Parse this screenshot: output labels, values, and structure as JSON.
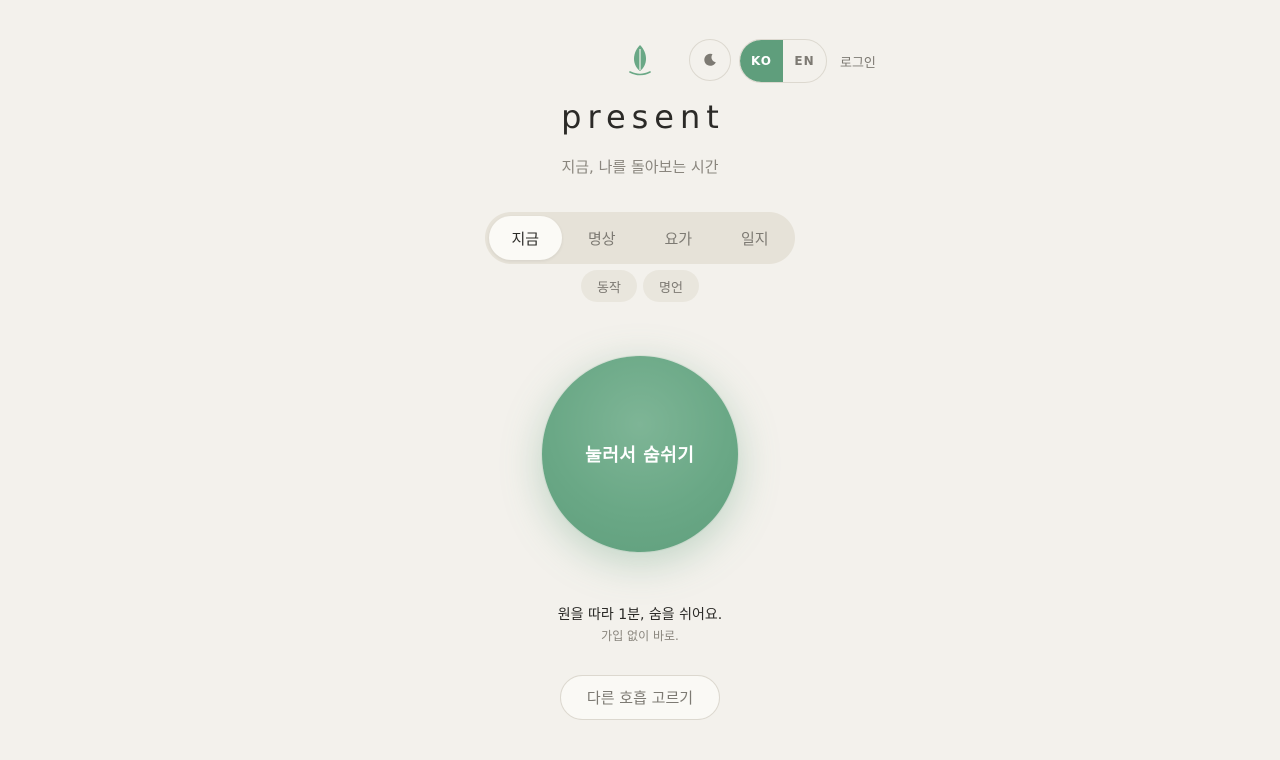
{
  "header": {
    "logo_icon": "leaf-icon",
    "theme_icon": "moon-icon",
    "languages": [
      {
        "code": "KO",
        "active": true
      },
      {
        "code": "EN",
        "active": false
      }
    ],
    "login_label": "로그인"
  },
  "hero": {
    "title": "present",
    "subtitle": "지금, 나를 돌아보는 시간"
  },
  "tabs": {
    "main": [
      {
        "label": "지금",
        "active": true
      },
      {
        "label": "명상",
        "active": false
      },
      {
        "label": "요가",
        "active": false
      },
      {
        "label": "일지",
        "active": false
      }
    ],
    "sub": [
      {
        "label": "동작"
      },
      {
        "label": "명언"
      }
    ]
  },
  "breath": {
    "button_label": "눌러서 숨쉬기",
    "hint_primary": "원을 따라 1분, 숨을 쉬어요.",
    "hint_secondary": "가입 없이 바로.",
    "other_label": "다른 호흡 고르기"
  },
  "colors": {
    "background": "#f3f1ec",
    "accent": "#5f9e7c",
    "text_muted": "#8a867e"
  }
}
